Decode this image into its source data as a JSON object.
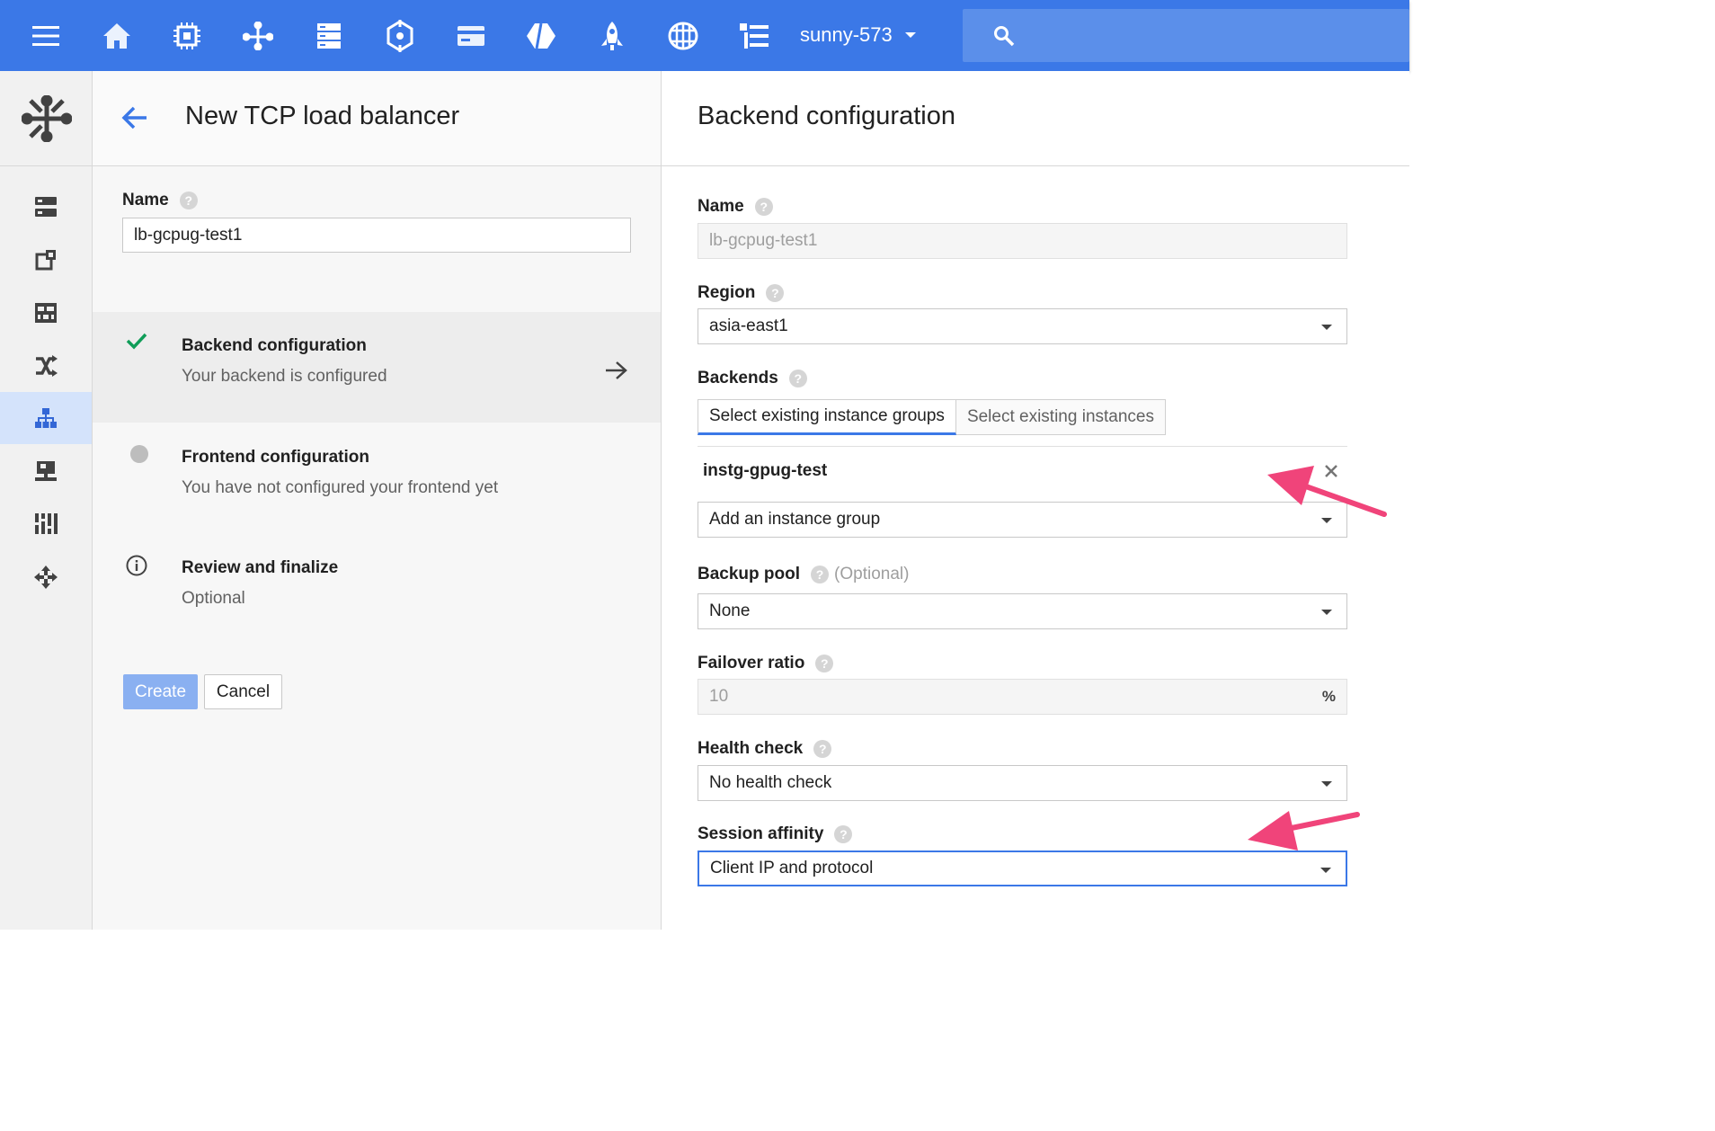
{
  "topbar": {
    "menu_icon": "hamburger-menu-icon",
    "product_icons": [
      "home-icon",
      "compute-engine-icon",
      "networking-icon",
      "storage-icon",
      "dataflow-icon",
      "billing-icon",
      "app-engine-icon",
      "deployment-icon",
      "ml-api-icon",
      "logs-icon"
    ],
    "project_name": "sunny-573",
    "search_icon": "search-icon",
    "color": "#3b78e7"
  },
  "leftnav": {
    "header_icon": "networking-icon",
    "items": [
      {
        "icon": "networks-icon",
        "active": false
      },
      {
        "icon": "external-ip-icon",
        "active": false
      },
      {
        "icon": "firewall-icon",
        "active": false
      },
      {
        "icon": "routes-icon",
        "active": false
      },
      {
        "icon": "load-balancing-icon",
        "active": true
      },
      {
        "icon": "vpn-icon",
        "active": false
      },
      {
        "icon": "cloud-dns-icon",
        "active": false
      },
      {
        "icon": "advanced-routing-icon",
        "active": false
      }
    ]
  },
  "wizard": {
    "title": "New TCP load balancer",
    "name_label": "Name",
    "name_value": "lb-gcpug-test1",
    "steps": [
      {
        "title": "Backend configuration",
        "subtitle": "Your backend is configured",
        "status": "done"
      },
      {
        "title": "Frontend configuration",
        "subtitle": "You have not configured your frontend yet",
        "status": "pending"
      },
      {
        "title": "Review and finalize",
        "subtitle": "Optional",
        "status": "info"
      }
    ],
    "create_label": "Create",
    "cancel_label": "Cancel"
  },
  "backend": {
    "title": "Backend configuration",
    "name_label": "Name",
    "name_value": "lb-gcpug-test1",
    "region_label": "Region",
    "region_value": "asia-east1",
    "backends_label": "Backends",
    "tabs": [
      "Select existing instance groups",
      "Select existing instances"
    ],
    "instance_group": "instg-gpug-test",
    "add_group_label": "Add an instance group",
    "backup_pool_label": "Backup pool",
    "backup_pool_optional": "(Optional)",
    "backup_pool_value": "None",
    "failover_label": "Failover ratio",
    "failover_value": "10",
    "failover_unit": "%",
    "health_check_label": "Health check",
    "health_check_value": "No health check",
    "session_affinity_label": "Session affinity",
    "session_affinity_value": "Client IP and protocol",
    "help_glyph": "?",
    "close_glyph": "✕"
  },
  "annotation_color": "#f0447a"
}
